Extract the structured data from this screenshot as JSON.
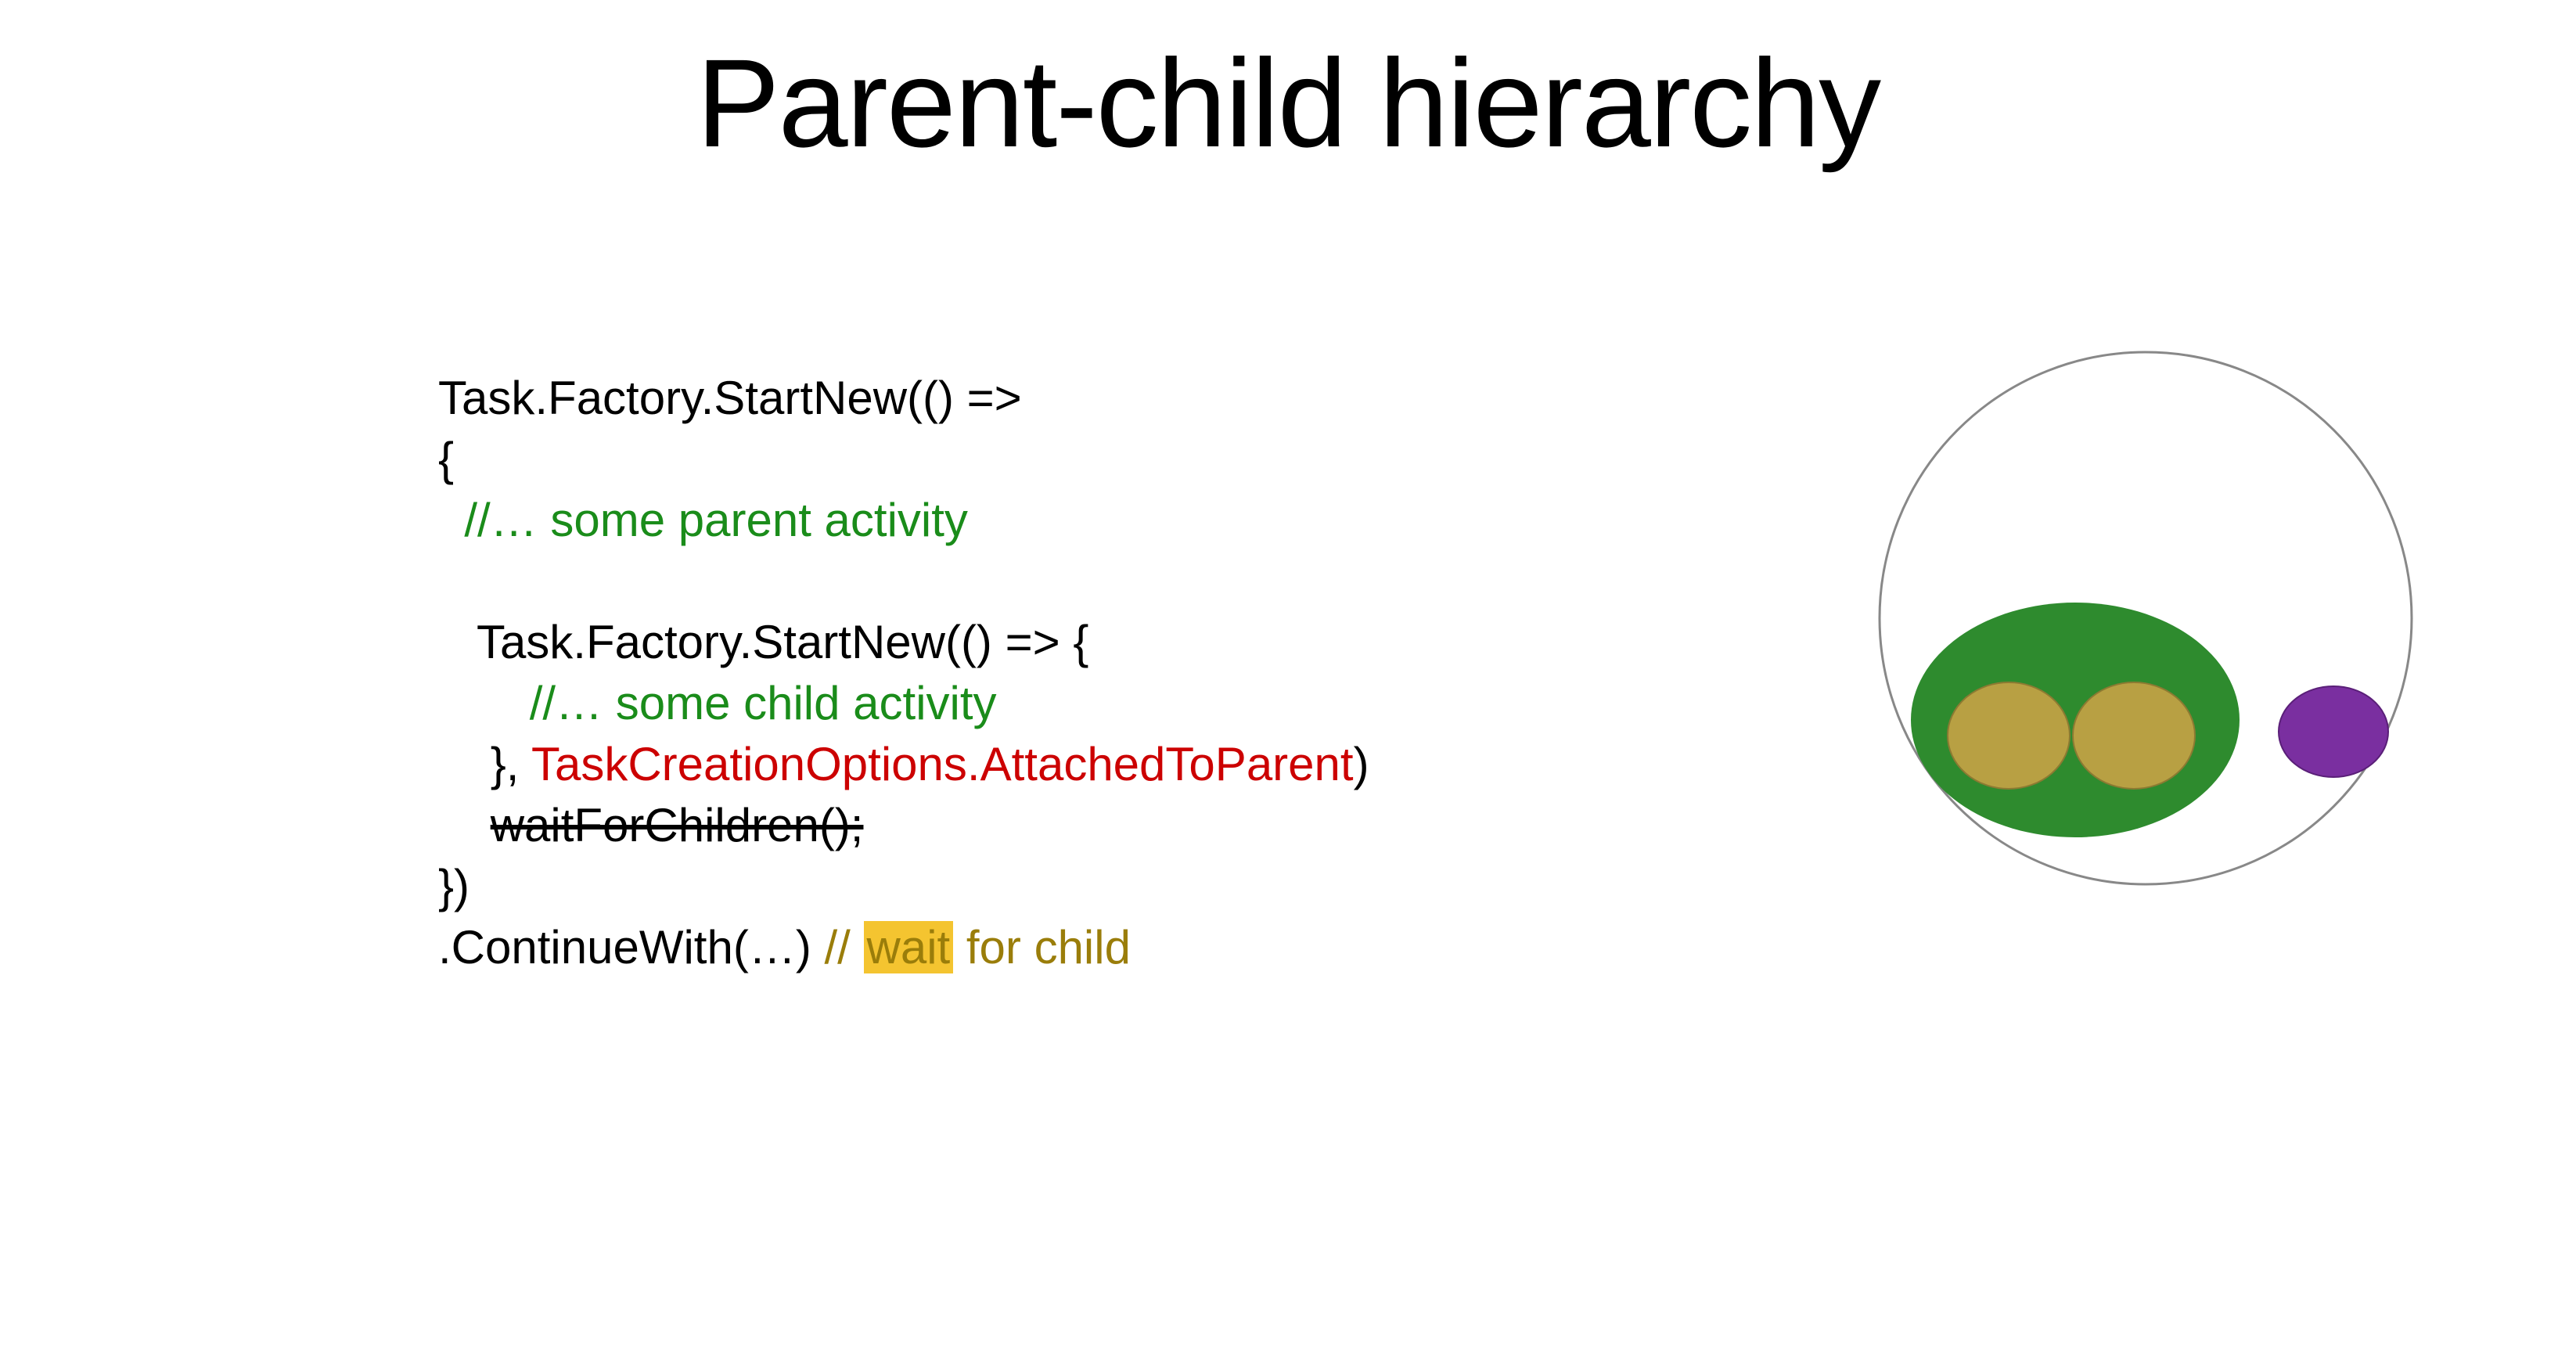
{
  "title": "Parent-child hierarchy",
  "code": {
    "line1": "Task.Factory.StartNew(() =>",
    "line2": "{",
    "line3_indent": "  ",
    "line3_comment": "//… some parent activity",
    "line4": "",
    "line5_indent": "   ",
    "line5": "Task.Factory.StartNew(() => {",
    "line6_indent": "       ",
    "line6_comment": "//… some child activity",
    "line7_indent": "    ",
    "line7_close": "}, ",
    "line7_red": "TaskCreationOptions.AttachedToParent",
    "line7_close2": ")",
    "line8_indent": "    ",
    "line8_strike": "waitForChildren();",
    "line9": "})",
    "line10_a": ".ContinueWith(…) ",
    "line10_b": "// ",
    "line10_wait": "wait",
    "line10_c": " for child"
  },
  "diagram": {
    "outer_circle_stroke": "#888888",
    "green_ellipse_fill": "#2e8b2e",
    "gold_ellipse_fill": "#b8a043",
    "purple_ellipse_fill": "#7a2fa0"
  }
}
